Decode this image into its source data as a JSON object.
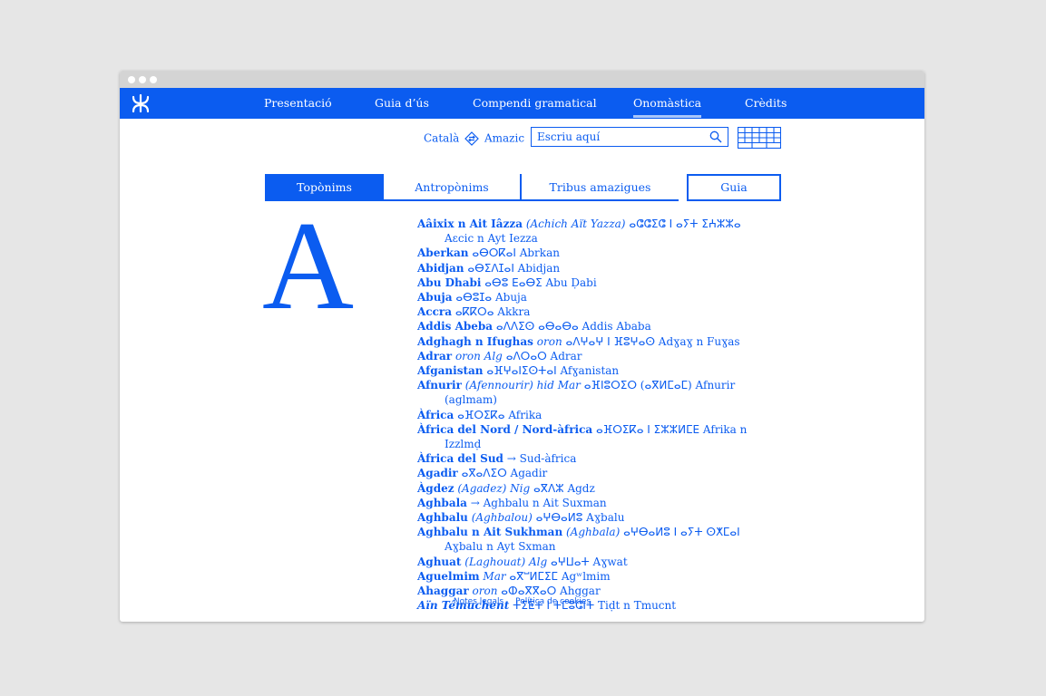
{
  "nav": {
    "items": [
      {
        "label": "Presentació"
      },
      {
        "label": "Guia d’ús"
      },
      {
        "label": "Compendi gramatical"
      },
      {
        "label": "Onomàstica"
      },
      {
        "label": "Crèdits"
      }
    ],
    "active": "Onomàstica"
  },
  "lang": {
    "from": "Català",
    "to": "Amazic"
  },
  "search": {
    "placeholder": "Escriu aquí"
  },
  "tabs": {
    "t1": "Topònims",
    "t2": "Antropònims",
    "t3": "Tribus amazigues",
    "t4": "Guia"
  },
  "letter": "A",
  "entries": [
    {
      "hw": "Aâixix n Ait Iâzza",
      "vr": "(Achich Aït Yazza)",
      "rest": "ⴰⵛⵛⵉⵛ ⵏ ⴰⵢⵜ ⵉⵄⵣⵣⴰ Aɛcic n Ayt Iezza"
    },
    {
      "hw": "Aberkan",
      "vr": "",
      "rest": "ⴰⴱⵔⴽⴰⵏ Abrkan"
    },
    {
      "hw": "Abidjan",
      "vr": "",
      "rest": "ⴰⴱⵉⴷⵊⴰⵏ Abidjan"
    },
    {
      "hw": "Abu Dhabi",
      "vr": "",
      "rest": "ⴰⴱⵓ ⴹⴰⴱⵉ Abu Ḍabi"
    },
    {
      "hw": "Abuja",
      "vr": "",
      "rest": "ⴰⴱⵓⵊⴰ Abuja"
    },
    {
      "hw": "Accra",
      "vr": "",
      "rest": "ⴰⴽⴽⵔⴰ Akkra"
    },
    {
      "hw": "Addis Abeba",
      "vr": "",
      "rest": "ⴰⴷⴷⵉⵙ ⴰⴱⴰⴱⴰ Addis Ababa"
    },
    {
      "hw": "Adghagh n Ifughas",
      "vr": "oron",
      "rest": "ⴰⴷⵖⴰⵖ ⵏ ⴼⵓⵖⴰⵙ Adɣaɣ n Fuɣas"
    },
    {
      "hw": "Adrar",
      "vr": "oron Alg",
      "rest": "ⴰⴷⵔⴰⵔ Adrar"
    },
    {
      "hw": "Afganistan",
      "vr": "",
      "rest": "ⴰⴼⵖⴰⵏⵉⵙⵜⴰⵏ Afɣanistan"
    },
    {
      "hw": "Afnurir",
      "vr": "(Afennourir) hid Mar",
      "rest": "ⴰⴼⵏⵓⵔⵉⵔ (ⴰⴳⵍⵎⴰⵎ) Afnurir (aglmam)"
    },
    {
      "hw": "Àfrica",
      "vr": "",
      "rest": "ⴰⴼⵔⵉⴽⴰ Afrika"
    },
    {
      "hw": "Àfrica del Nord / Nord-àfrica",
      "vr": "",
      "rest": "ⴰⴼⵔⵉⴽⴰ ⵏ ⵉⵣⵣⵍⵎⴹ Afrika n Izzlmḍ"
    },
    {
      "hw": "Àfrica del Sud",
      "vr": "",
      "rest": "→ Sud-àfrica"
    },
    {
      "hw": "Agadir",
      "vr": "",
      "rest": "ⴰⴳⴰⴷⵉⵔ Agadir"
    },
    {
      "hw": "Àgdez",
      "vr": "(Agadez) Nig",
      "rest": "ⴰⴳⴷⵣ Agdz"
    },
    {
      "hw": "Aghbala",
      "vr": "",
      "rest": "→ Aghbalu n Ait Suxman"
    },
    {
      "hw": "Aghbalu",
      "vr": "(Aghbalou)",
      "rest": "ⴰⵖⴱⴰⵍⵓ Aɣbalu"
    },
    {
      "hw": "Aghbalu n Ait Sukhman",
      "vr": "(Aghbala)",
      "rest": "ⴰⵖⴱⴰⵍⵓ ⵏ ⴰⵢⵜ ⵙⵅⵎⴰⵏ Aɣbalu n Ayt Sxman"
    },
    {
      "hw": "Aghuat",
      "vr": "(Laghouat) Alg",
      "rest": "ⴰⵖⵡⴰⵜ Aɣwat"
    },
    {
      "hw": "Aguelmim",
      "vr": "Mar",
      "rest": "ⴰⴳⵯⵍⵎⵉⵎ Agʷlmim"
    },
    {
      "hw": "Ahaggar",
      "vr": "oron",
      "rest": "ⴰⵀⴰⴳⴳⴰⵔ Ahggar"
    },
    {
      "hw": "Aïn Témuchent",
      "vr": "",
      "rest": "ⵜⵉⵟⵜ ⵏ ⵜⵎⵓⵛⵏⵜ Tiḍt n Tmucnt"
    }
  ],
  "footer": {
    "legal": "Notes legals",
    "cookies": "Política de cookies"
  },
  "colors": {
    "accent": "#0b5cf0",
    "background": "#ffffff",
    "page": "#e6e6e6"
  }
}
